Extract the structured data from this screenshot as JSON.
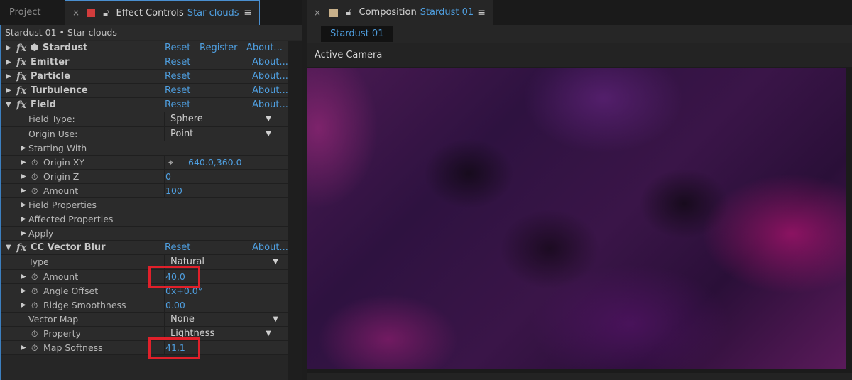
{
  "left_panel": {
    "tabs": {
      "project": "Project",
      "effect_controls": "Effect Controls",
      "effect_controls_target": "Star clouds"
    },
    "breadcrumb": "Stardust 01 • Star clouds",
    "effects": {
      "stardust": {
        "name": "Stardust",
        "reset": "Reset",
        "register": "Register",
        "about": "About..."
      },
      "emitter": {
        "name": "Emitter",
        "reset": "Reset",
        "about": "About..."
      },
      "particle": {
        "name": "Particle",
        "reset": "Reset",
        "about": "About..."
      },
      "turbulence": {
        "name": "Turbulence",
        "reset": "Reset",
        "about": "About..."
      },
      "field": {
        "name": "Field",
        "reset": "Reset",
        "about": "About..."
      },
      "vector_blur": {
        "name": "CC Vector Blur",
        "reset": "Reset",
        "about": "About..."
      }
    },
    "field_props": {
      "field_type": {
        "label": "Field Type:",
        "value": "Sphere"
      },
      "origin_use": {
        "label": "Origin Use:",
        "value": "Point"
      },
      "starting_with": "Starting With",
      "origin_xy": {
        "label": "Origin XY",
        "value": "640.0,360.0"
      },
      "origin_z": {
        "label": "Origin Z",
        "value": "0"
      },
      "amount": {
        "label": "Amount",
        "value": "100"
      },
      "field_properties": "Field Properties",
      "affected_properties": "Affected Properties",
      "apply": "Apply"
    },
    "blur_props": {
      "type": {
        "label": "Type",
        "value": "Natural"
      },
      "amount": {
        "label": "Amount",
        "value": "40.0"
      },
      "angle_offset": {
        "label": "Angle Offset",
        "value": "0x+0.0°"
      },
      "ridge_smoothness": {
        "label": "Ridge Smoothness",
        "value": "0.00"
      },
      "vector_map": {
        "label": "Vector Map",
        "value": "None"
      },
      "property": {
        "label": "Property",
        "value": "Lightness"
      },
      "map_softness": {
        "label": "Map Softness",
        "value": "41.1"
      }
    }
  },
  "right_panel": {
    "tab_title": "Composition",
    "tab_target": "Stardust 01",
    "subtab": "Stardust 01",
    "camera_label": "Active Camera"
  },
  "colors": {
    "accent_blue": "#4f9fe0",
    "highlight_red": "#e0202a",
    "effect_swatch": "#d23c3c",
    "comp_swatch": "#c8b08a"
  }
}
